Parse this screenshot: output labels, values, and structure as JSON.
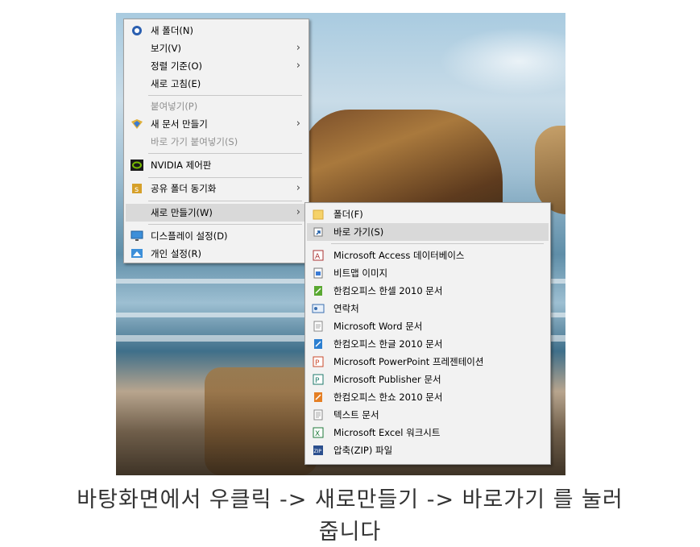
{
  "context_menu": {
    "items": [
      {
        "label": "새 폴더(N)",
        "icon": "new-folder-icon"
      },
      {
        "label": "보기(V)"
      },
      {
        "label": "정렬 기준(O)"
      },
      {
        "label": "새로 고침(E)"
      },
      {
        "label": "붙여넣기(P)"
      },
      {
        "label": "새 문서 만들기",
        "icon": "new-document-icon"
      },
      {
        "label": "바로 가기 붙여넣기(S)"
      },
      {
        "label": "NVIDIA 제어판",
        "icon": "nvidia-icon"
      },
      {
        "label": "공유 폴더 동기화",
        "icon": "sync-folder-icon"
      },
      {
        "label": "새로 만들기(W)"
      },
      {
        "label": "디스플레이 설정(D)",
        "icon": "display-icon"
      },
      {
        "label": "개인 설정(R)",
        "icon": "personalize-icon"
      }
    ],
    "arrow": "›"
  },
  "submenu": {
    "items": [
      {
        "label": "폴더(F)",
        "icon": "folder-icon"
      },
      {
        "label": "바로 가기(S)",
        "icon": "shortcut-icon"
      },
      {
        "label": "Microsoft Access 데이터베이스",
        "icon": "access-icon"
      },
      {
        "label": "비트맵 이미지",
        "icon": "bitmap-icon"
      },
      {
        "label": "한컴오피스 한셀 2010 문서",
        "icon": "hancell-icon"
      },
      {
        "label": "연락처",
        "icon": "contact-icon"
      },
      {
        "label": "Microsoft Word 문서",
        "icon": "word-icon"
      },
      {
        "label": "한컴오피스 한글 2010 문서",
        "icon": "hangul-icon"
      },
      {
        "label": "Microsoft PowerPoint 프레젠테이션",
        "icon": "powerpoint-icon"
      },
      {
        "label": "Microsoft Publisher 문서",
        "icon": "publisher-icon"
      },
      {
        "label": "한컴오피스 한쇼 2010 문서",
        "icon": "hanshow-icon"
      },
      {
        "label": "텍스트 문서",
        "icon": "text-document-icon"
      },
      {
        "label": "Microsoft Excel 워크시트",
        "icon": "excel-icon"
      },
      {
        "label": "압축(ZIP) 파일",
        "icon": "zip-icon"
      }
    ]
  },
  "caption": {
    "line1": "바탕화면에서 우클릭 -> 새로만들기 -> 바로가기 를 눌러",
    "line2": "줍니다"
  }
}
